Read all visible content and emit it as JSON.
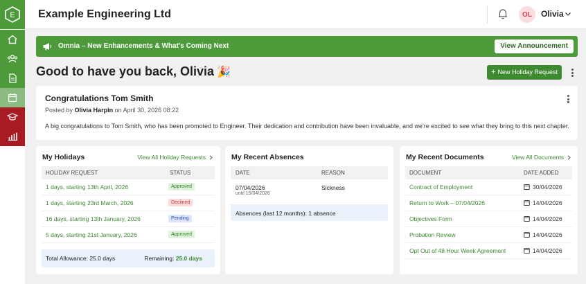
{
  "app": {
    "logo_letter": "E",
    "company": "Example Engineering Ltd",
    "accent": "#4d9a3a",
    "sidebar_icons": [
      "home-icon",
      "people-icon",
      "document-icon",
      "calendar-icon",
      "graduation-cap-icon",
      "bar-chart-icon"
    ]
  },
  "user": {
    "initials": "OL",
    "name": "Olivia"
  },
  "announcement": {
    "text": "Omnia – New Enhancements & What's Coming Next",
    "button": "View Announcement"
  },
  "greeting": {
    "text": "Good to have you back, Olivia",
    "emoji": "🎉"
  },
  "new_holiday_button": "New Holiday Request",
  "post": {
    "title": "Congratulations Tom Smith",
    "posted_by_prefix": "Posted by",
    "author": "Olivia Harpin",
    "posted_on": "on April 30, 2026 08:22",
    "body": "A big congratulations to Tom Smith, who has been promoted to Engineer. Their dedication and contribution have been invaluable, and we're excited to see what they bring to this next chapter."
  },
  "holidays": {
    "title": "My Holidays",
    "link": "View All Holiday Requests",
    "columns": [
      "HOLIDAY REQUEST",
      "STATUS"
    ],
    "rows": [
      {
        "label": "1 days, starting 13th April, 2026",
        "status": "Approved"
      },
      {
        "label": "1 days, starting 23rd March, 2026",
        "status": "Declined"
      },
      {
        "label": "16 days, starting 13th January, 2026",
        "status": "Pending"
      },
      {
        "label": "5 days, starting 21st January, 2026",
        "status": "Approved"
      }
    ],
    "allowance_label": "Total Allowance: 25.0 days",
    "remaining_label": "Remaining:",
    "remaining_value": "25.0 days"
  },
  "absences": {
    "title": "My Recent Absences",
    "columns": [
      "DATE",
      "REASON"
    ],
    "rows": [
      {
        "date": "07/04/2026",
        "until": "until 15/04/2026",
        "reason": "Sickness"
      }
    ],
    "summary": "Absences (last 12 months): 1 absence"
  },
  "documents": {
    "title": "My Recent Documents",
    "link": "View All Documents",
    "columns": [
      "DOCUMENT",
      "DATE ADDED"
    ],
    "rows": [
      {
        "name": "Contract of Employment",
        "date": "30/04/2026"
      },
      {
        "name": "Return to Work – 07/04/2026",
        "date": "14/04/2026"
      },
      {
        "name": "Objectives Form",
        "date": "14/04/2026"
      },
      {
        "name": "Probation Review",
        "date": "14/04/2026"
      },
      {
        "name": "Opt Out of 48 Hour Week Agreement",
        "date": "14/04/2026"
      }
    ]
  }
}
